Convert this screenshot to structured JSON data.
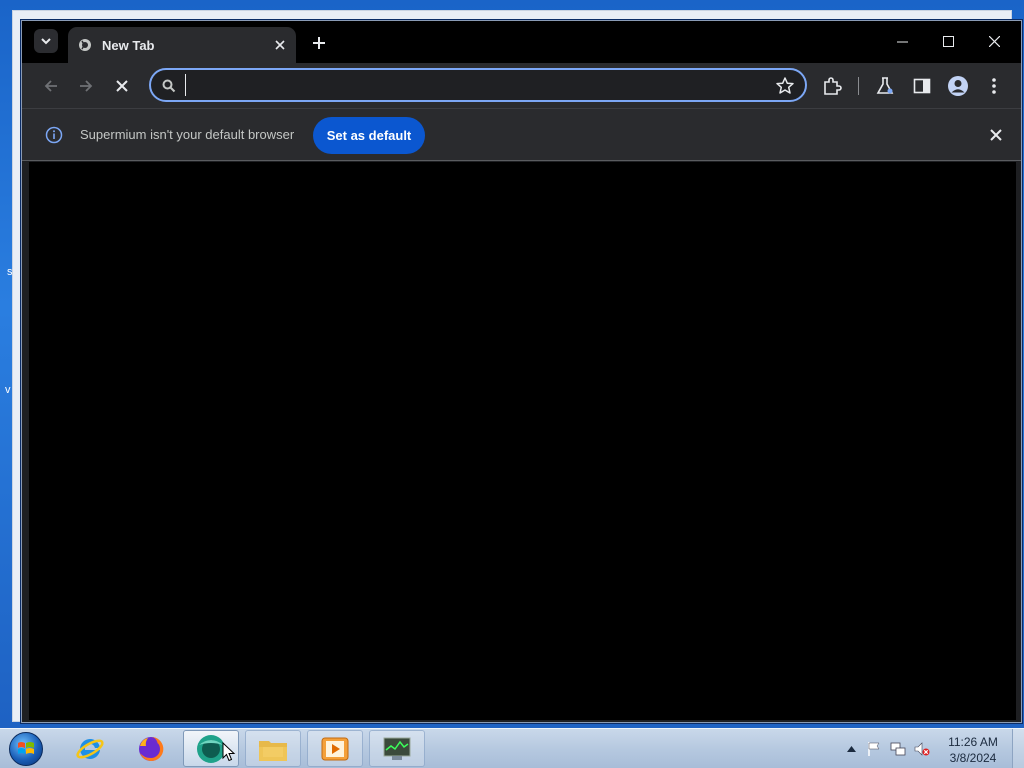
{
  "browser": {
    "tab": {
      "title": "New Tab"
    },
    "omnibox": {
      "value": "",
      "placeholder": ""
    },
    "infobar": {
      "message": "Supermium isn't your default browser",
      "button_label": "Set as default"
    }
  },
  "taskbar": {
    "apps": [
      {
        "name": "internet-explorer",
        "state": "pinned"
      },
      {
        "name": "firefox",
        "state": "pinned"
      },
      {
        "name": "supermium",
        "state": "active"
      },
      {
        "name": "file-explorer",
        "state": "running"
      },
      {
        "name": "media-player",
        "state": "running"
      },
      {
        "name": "task-manager",
        "state": "running"
      }
    ],
    "clock": {
      "time": "11:26 AM",
      "date": "3/8/2024"
    }
  },
  "colors": {
    "accent": "#0b57d0",
    "omnibox_focus": "#7ca7f5",
    "toolbar_bg": "#2a2b2e",
    "content_bg": "#000000"
  }
}
